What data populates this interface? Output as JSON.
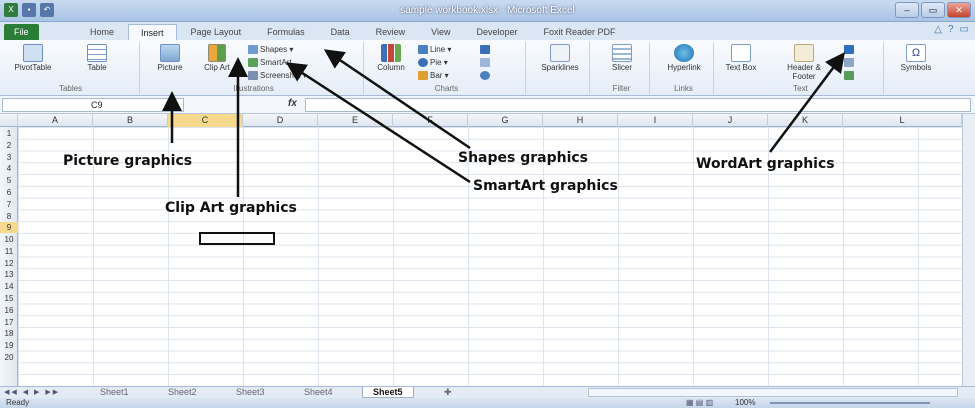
{
  "window": {
    "title": "sample workbook.xlsx - Microsoft Excel",
    "controls": [
      "–",
      "▭",
      "✕"
    ]
  },
  "ribbon_tabs": [
    "File",
    "Home",
    "Insert",
    "Page Layout",
    "Formulas",
    "Data",
    "Review",
    "View",
    "Developer",
    "Foxit Reader PDF"
  ],
  "active_tab": "Insert",
  "groups": {
    "tables": {
      "label": "Tables",
      "pivot": "PivotTable",
      "table": "Table"
    },
    "illustrations": {
      "label": "Illustrations",
      "picture": "Picture",
      "clip_art": "Clip Art",
      "shapes": "Shapes ▾",
      "smartart": "SmartArt",
      "screenshot": "Screenshot ▾"
    },
    "charts": {
      "label": "Charts",
      "column": "Column",
      "line": "Line ▾",
      "pie": "Pie ▾",
      "bar": "Bar ▾"
    },
    "sparklines": {
      "label": "Sparklines"
    },
    "filter": {
      "label": "Filter",
      "slicer": "Slicer"
    },
    "links": {
      "label": "Links",
      "hyperlink": "Hyperlink"
    },
    "text": {
      "label": "Text",
      "textbox": "Text Box",
      "header_footer": "Header & Footer"
    },
    "symbols": {
      "label": "Symbols"
    }
  },
  "name_box": "C9",
  "fx_label": "fx",
  "columns": [
    "A",
    "B",
    "C",
    "D",
    "E",
    "F",
    "G",
    "H",
    "I",
    "J",
    "K",
    "L"
  ],
  "rows": [
    "1",
    "2",
    "3",
    "4",
    "5",
    "6",
    "7",
    "8",
    "9",
    "10",
    "11",
    "12",
    "13",
    "14",
    "15",
    "16",
    "17",
    "18",
    "19",
    "20"
  ],
  "sheets": [
    "Sheet1",
    "Sheet2",
    "Sheet3",
    "Sheet4",
    "Sheet5"
  ],
  "active_sheet": "Sheet5",
  "status": {
    "ready": "Ready",
    "zoom": "100%"
  },
  "annotations": {
    "picture": "Picture graphics",
    "clipart": "Clip Art graphics",
    "shapes": "Shapes graphics",
    "smartart": "SmartArt graphics",
    "wordart": "WordArt graphics"
  }
}
